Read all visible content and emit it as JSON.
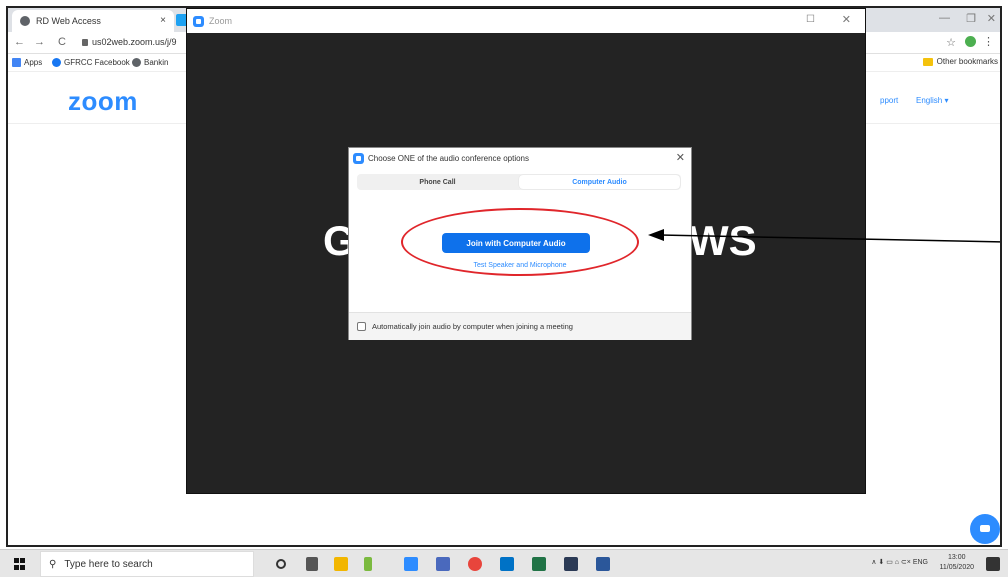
{
  "browser": {
    "tab_title": "RD Web Access",
    "tab_close": "×",
    "nav_back": "←",
    "nav_forward": "→",
    "nav_reload": "C",
    "url": "us02web.zoom.us/j/9",
    "bookmarks": [
      "Apps",
      "GFRCC Facebook",
      "Bankin"
    ],
    "other_bookmarks": "Other bookmarks",
    "window_min": "—",
    "window_max": "❐",
    "window_close": "✕",
    "star": "☆",
    "menu": "⋮"
  },
  "zoom_page": {
    "logo": "zoom",
    "support": "pport",
    "language": "English ▾"
  },
  "zoom_window": {
    "title": "Zoom",
    "maximize": "☐",
    "close": "✕",
    "bg_text_left": "G",
    "bg_text_right": "WS"
  },
  "dialog": {
    "title": "Choose ONE of the audio conference options",
    "close": "✕",
    "tabs": [
      "Phone Call",
      "Computer Audio"
    ],
    "join_button": "Join with Computer Audio",
    "test_link": "Test Speaker and Microphone",
    "auto_join": "Automatically join audio by computer when joining a meeting"
  },
  "taskbar": {
    "search_placeholder": "Type here to search",
    "search_icon": "⚲",
    "tray": "∧  ⬇  ▭  ⌂  ⊂×  ENG",
    "time": "13:00",
    "date": "11/05/2020"
  },
  "colors": {
    "zoom_blue": "#2d8cff",
    "button_blue": "#0e71eb",
    "annotation_red": "#e0262b"
  }
}
